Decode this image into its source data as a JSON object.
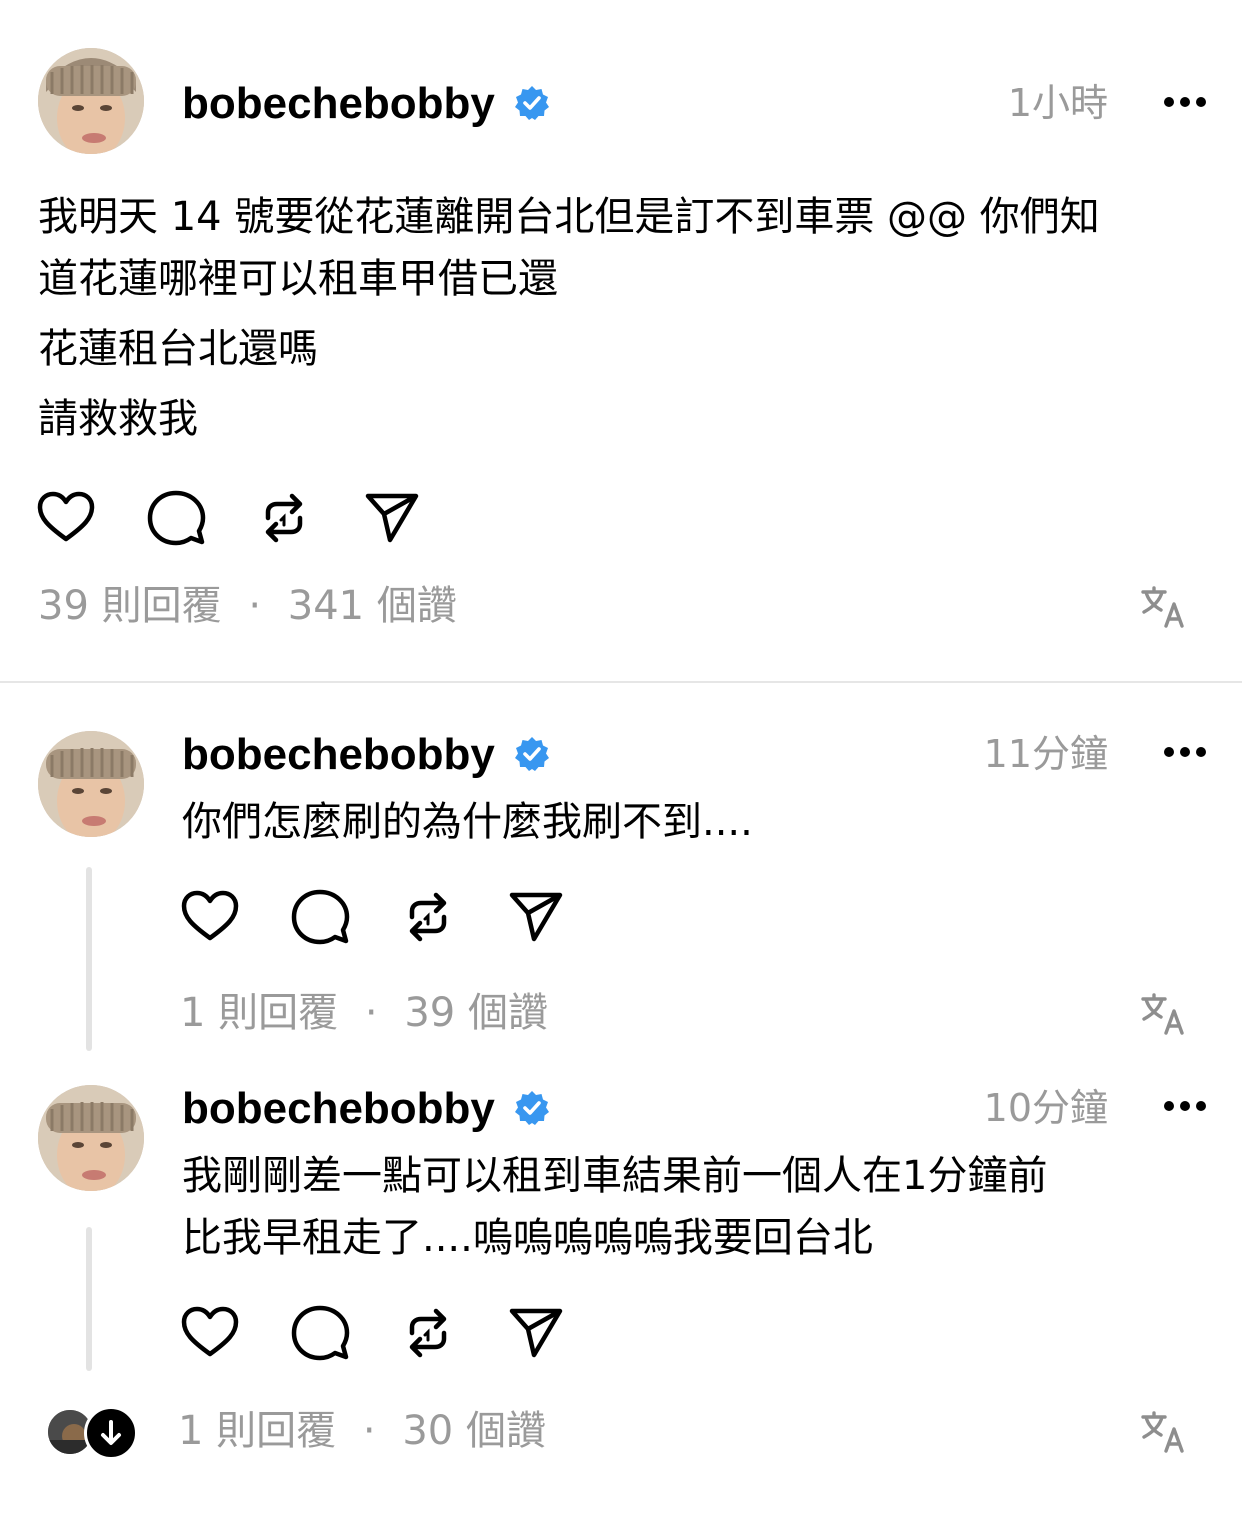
{
  "posts": [
    {
      "username": "bobechebobby",
      "time": "1小時",
      "lines": [
        "我明天 14 號要從花蓮離開台北但是訂不到車票 @@ 你們知",
        "道花蓮哪裡可以租車甲借已還",
        "花蓮租台北還嗎",
        "請救救我"
      ],
      "replies": "39 則回覆",
      "likes": "341 個讚"
    },
    {
      "username": "bobechebobby",
      "time": "11分鐘",
      "lines": [
        "你們怎麼刷的為什麼我刷不到...."
      ],
      "replies": "1 則回覆",
      "likes": "39 個讚"
    },
    {
      "username": "bobechebobby",
      "time": "10分鐘",
      "lines": [
        "我剛剛差一點可以租到車結果前一個人在1分鐘前",
        "比我早租走了....嗚嗚嗚嗚嗚我要回台北"
      ],
      "replies": "1 則回覆",
      "likes": "30 個讚"
    }
  ],
  "separator": "·",
  "icons": [
    "verified-badge-icon",
    "more-icon",
    "heart-icon",
    "comment-icon",
    "repost-icon",
    "share-icon",
    "translate-icon",
    "arrow-down-icon"
  ],
  "colors": {
    "verified": "#3897f0",
    "muted": "#9a9a9a",
    "divider": "#e6e6e6"
  }
}
